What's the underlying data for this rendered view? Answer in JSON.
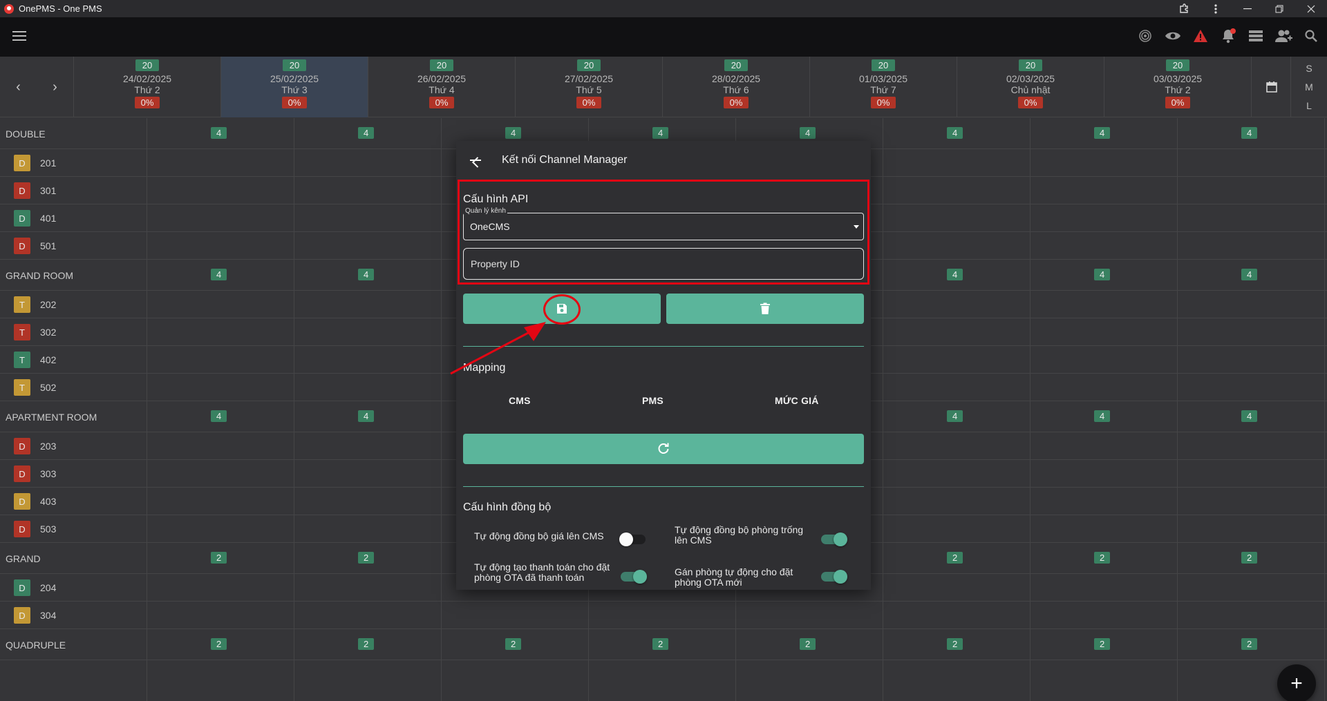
{
  "window": {
    "title": "OnePMS - One PMS"
  },
  "days": [
    {
      "count": "20",
      "date": "24/02/2025",
      "weekday": "Thứ 2",
      "occupancy": "0%",
      "active": false
    },
    {
      "count": "20",
      "date": "25/02/2025",
      "weekday": "Thứ 3",
      "occupancy": "0%",
      "active": true
    },
    {
      "count": "20",
      "date": "26/02/2025",
      "weekday": "Thứ 4",
      "occupancy": "0%",
      "active": false
    },
    {
      "count": "20",
      "date": "27/02/2025",
      "weekday": "Thứ 5",
      "occupancy": "0%",
      "active": false
    },
    {
      "count": "20",
      "date": "28/02/2025",
      "weekday": "Thứ 6",
      "occupancy": "0%",
      "active": false
    },
    {
      "count": "20",
      "date": "01/03/2025",
      "weekday": "Thứ 7",
      "occupancy": "0%",
      "active": false
    },
    {
      "count": "20",
      "date": "02/03/2025",
      "weekday": "Chủ nhật",
      "occupancy": "0%",
      "active": false
    },
    {
      "count": "20",
      "date": "03/03/2025",
      "weekday": "Thứ 2",
      "occupancy": "0%",
      "active": false
    }
  ],
  "view_tabs": [
    "S",
    "M",
    "L"
  ],
  "rows": [
    {
      "type": "category",
      "name": "DOUBLE",
      "avail": "4"
    },
    {
      "type": "room",
      "name": "201",
      "tag": "D",
      "color": "#d4a53a"
    },
    {
      "type": "room",
      "name": "301",
      "tag": "D",
      "color": "#c0392b"
    },
    {
      "type": "room",
      "name": "401",
      "tag": "D",
      "color": "#3e8d6a"
    },
    {
      "type": "room",
      "name": "501",
      "tag": "D",
      "color": "#c0392b"
    },
    {
      "type": "category",
      "name": "GRAND ROOM",
      "avail": "4"
    },
    {
      "type": "room",
      "name": "202",
      "tag": "T",
      "color": "#d4a53a"
    },
    {
      "type": "room",
      "name": "302",
      "tag": "T",
      "color": "#c0392b"
    },
    {
      "type": "room",
      "name": "402",
      "tag": "T",
      "color": "#3e8d6a"
    },
    {
      "type": "room",
      "name": "502",
      "tag": "T",
      "color": "#d4a53a"
    },
    {
      "type": "category",
      "name": "APARTMENT ROOM",
      "avail": "4"
    },
    {
      "type": "room",
      "name": "203",
      "tag": "D",
      "color": "#c0392b"
    },
    {
      "type": "room",
      "name": "303",
      "tag": "D",
      "color": "#c0392b"
    },
    {
      "type": "room",
      "name": "403",
      "tag": "D",
      "color": "#d4a53a"
    },
    {
      "type": "room",
      "name": "503",
      "tag": "D",
      "color": "#c0392b"
    },
    {
      "type": "category",
      "name": "GRAND",
      "avail": "2"
    },
    {
      "type": "room",
      "name": "204",
      "tag": "D",
      "color": "#3e8d6a"
    },
    {
      "type": "room",
      "name": "304",
      "tag": "D",
      "color": "#d4a53a"
    },
    {
      "type": "category",
      "name": "QUADRUPLE",
      "avail": "2"
    }
  ],
  "dialog": {
    "title": "Kết nối Channel Manager",
    "api_section": "Cấu hình API",
    "channel_label": "Quản lý kênh",
    "channel_value": "OneCMS",
    "property_placeholder": "Property ID",
    "mapping_section": "Mapping",
    "mapping_columns": [
      "CMS",
      "PMS",
      "MỨC GIÁ"
    ],
    "sync_section": "Cấu hình đồng bộ",
    "sync_options": [
      {
        "label": "Tự động đồng bộ giá lên CMS",
        "on": false
      },
      {
        "label": "Tự động đồng bộ phòng trống lên CMS",
        "on": true
      },
      {
        "label": "Tự động tạo thanh toán cho đặt phòng OTA đã thanh toán",
        "on": true
      },
      {
        "label": "Gán phòng tự động cho đặt phòng OTA mới",
        "on": true
      }
    ]
  }
}
